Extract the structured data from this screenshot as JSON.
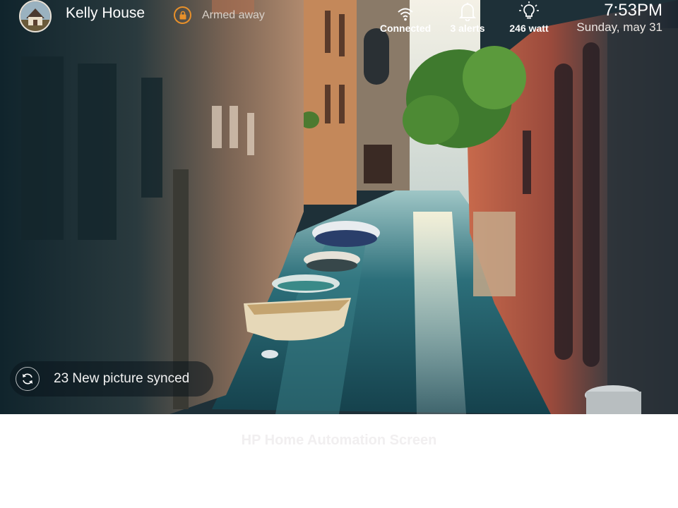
{
  "header": {
    "home_name": "Kelly House",
    "security_status": "Armed away",
    "wifi_status": "Connected",
    "alerts_label": "3 alerts",
    "power_label": "246 watt",
    "time": "7:53PM",
    "date": "Sunday, may 31"
  },
  "toast": {
    "message": "23 New picture synced"
  },
  "caption": "HP Home Automation Screen",
  "colors": {
    "accent": "#e8902a",
    "text": "#ffffff",
    "caption": "#f1eff0"
  },
  "icons": [
    "home-avatar-icon",
    "lock-icon",
    "wifi-icon",
    "bell-icon",
    "lightbulb-icon",
    "sync-icon"
  ]
}
